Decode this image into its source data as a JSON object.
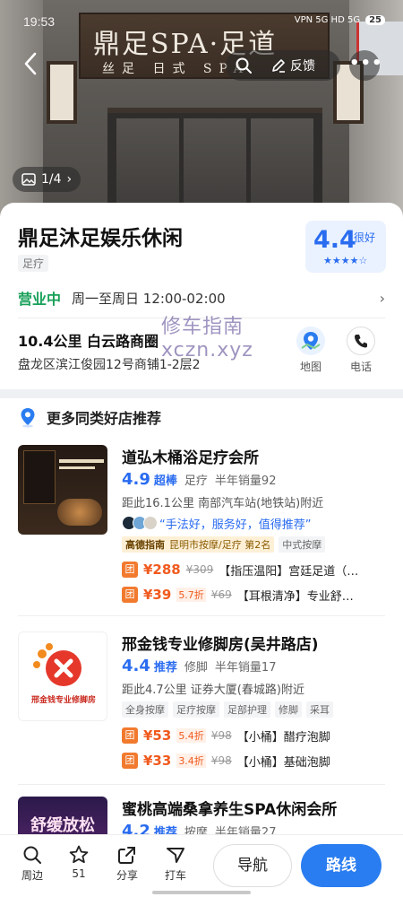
{
  "status": {
    "time": "19:53",
    "icons": "VPN 5G HD 5G",
    "battery": "25"
  },
  "hero": {
    "sign_big": "鼎足SPA·足道",
    "sign_small": "丝足 日式 SPA",
    "feedback_label": "反馈",
    "photo_count": "1/4"
  },
  "shop": {
    "name": "鼎足沐足娱乐休闲",
    "category": "足疗",
    "rating": "4.4",
    "rating_word": "很好",
    "stars": "★★★★☆",
    "open_status": "营业中",
    "hours": "周一至周日 12:00-02:00",
    "distance": "10.4公里  白云路商圈",
    "address": "盘龙区滨江俊园12号商铺1-2层2",
    "map_label": "地图",
    "phone_label": "电话"
  },
  "watermark": {
    "line1": "修车指南",
    "line2": "xczn.xyz"
  },
  "recommend": {
    "header": "更多同类好店推荐",
    "items": [
      {
        "name": "道弘木桶浴足疗会所",
        "score": "4.9",
        "level": "超棒",
        "category": "足疗",
        "sales": "半年销量92",
        "location": "距此16.1公里   南部汽车站(地铁站)附近",
        "review": "“手法好，服务好，值得推荐”",
        "badge_brand": "高德指南",
        "badge_text": "昆明市按摩/足疗 第2名",
        "tags": [
          "中式按摩"
        ],
        "deals": [
          {
            "icon": "团",
            "price": "¥288",
            "discount": "",
            "original": "¥309",
            "name": "【指压温阳】宫廷足道（…"
          },
          {
            "icon": "团",
            "price": "¥39",
            "discount": "5.7折",
            "original": "¥69",
            "name": "【耳根清净】专业舒…"
          }
        ]
      },
      {
        "name": "邢金钱专业修脚房(吴井路店)",
        "score": "4.4",
        "level": "推荐",
        "category": "修脚",
        "sales": "半年销量17",
        "location": "距此4.7公里   证券大厦(春城路)附近",
        "tags": [
          "全身按摩",
          "足疗按摩",
          "足部护理",
          "修脚",
          "采耳"
        ],
        "deals": [
          {
            "icon": "团",
            "price": "¥53",
            "discount": "5.4折",
            "original": "¥98",
            "name": "【小桶】醋疗泡脚"
          },
          {
            "icon": "团",
            "price": "¥33",
            "discount": "3.4折",
            "original": "¥98",
            "name": "【小桶】基础泡脚"
          }
        ]
      },
      {
        "name": "蜜桃高端桑拿养生SPA休闲会所",
        "score": "4.2",
        "level": "推荐",
        "category": "按摩",
        "sales": "半年销量27"
      }
    ],
    "thumb2_caption": "邢金钱专业修脚房",
    "thumb3_caption": "舒缓放松"
  },
  "bottombar": {
    "nearby": "周边",
    "favorites": "51",
    "share": "分享",
    "taxi": "打车",
    "navigate": "导航",
    "route": "路线"
  },
  "colors": {
    "accent": "#2a7df0",
    "open": "#18a058",
    "price": "#f05a1e"
  }
}
